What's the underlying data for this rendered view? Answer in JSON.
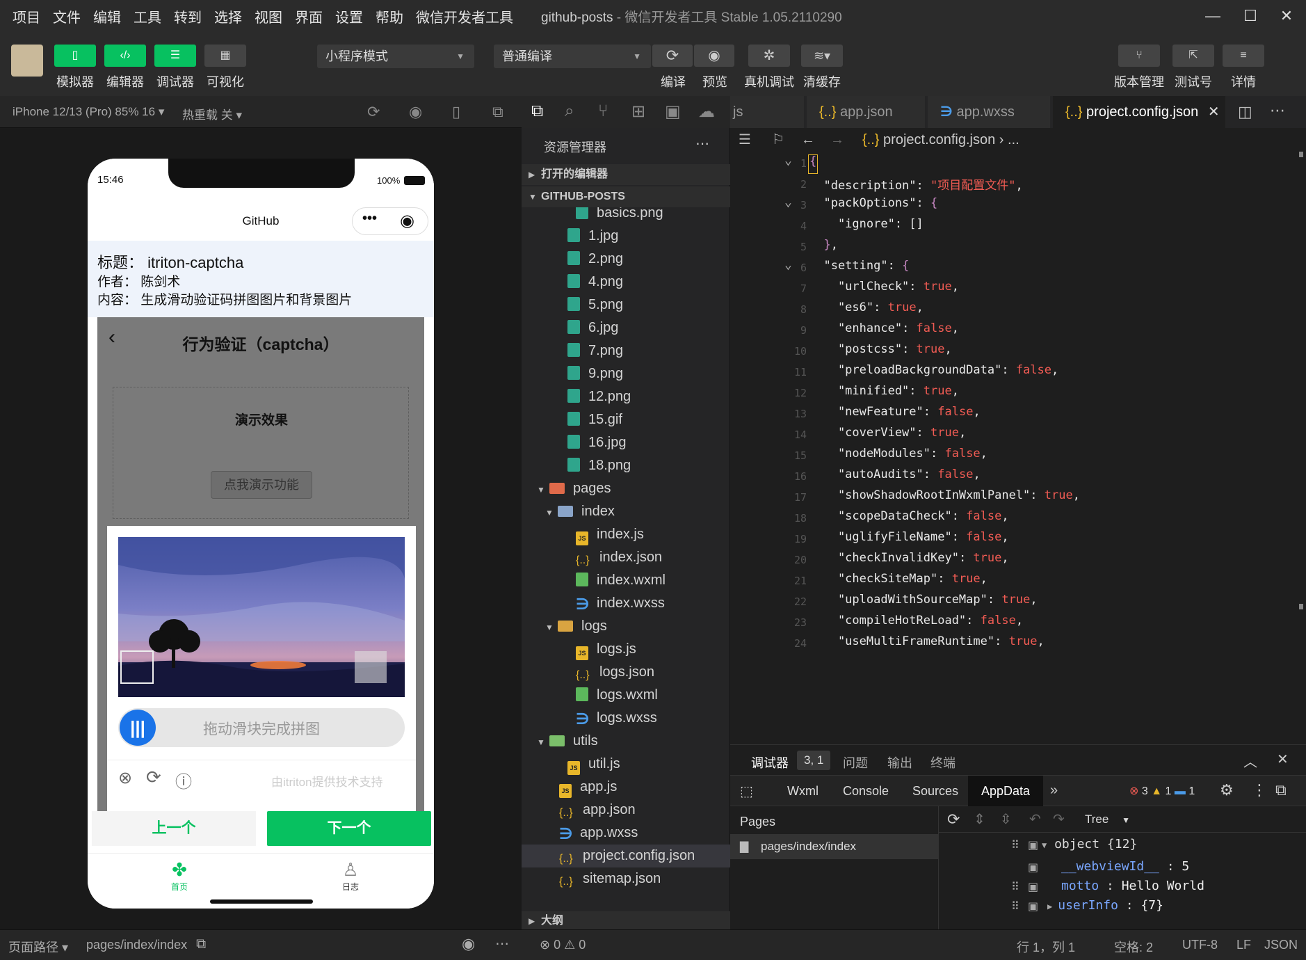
{
  "menubar": {
    "items": [
      "项目",
      "文件",
      "编辑",
      "工具",
      "转到",
      "选择",
      "视图",
      "界面",
      "设置",
      "帮助",
      "微信开发者工具"
    ],
    "project": "github-posts",
    "title_suffix": "- 微信开发者工具 Stable 1.05.2110290"
  },
  "toolbar": {
    "simulator": "模拟器",
    "editor": "编辑器",
    "debugger": "调试器",
    "visual": "可视化",
    "mode": "小程序模式",
    "compile_mode": "普通编译",
    "compile": "编译",
    "preview": "预览",
    "real_debug": "真机调试",
    "clear_cache": "清缓存",
    "version": "版本管理",
    "test_account": "测试号",
    "details": "详情"
  },
  "simbar": {
    "device": "iPhone 12/13 (Pro) 85% 16",
    "hot_reload": "热重载 关"
  },
  "phone": {
    "time": "15:46",
    "battery": "100%",
    "nav_title": "GitHub",
    "title_label": "标题：",
    "title_value": "itriton-captcha",
    "author_label": "作者：",
    "author_value": "陈剑术",
    "content_label": "内容：",
    "content_value": "生成滑动验证码拼图图片和背景图片",
    "captcha_title": "行为验证（captcha）",
    "demo_effect": "演示效果",
    "demo_button": "点我演示功能",
    "slider_text": "拖动滑块完成拼图",
    "powered_by": "由itriton提供技术支持",
    "prev": "上一个",
    "next": "下一个",
    "tab_home": "首页",
    "tab_logs": "日志"
  },
  "left_status": {
    "path_label": "页面路径",
    "path": "pages/index/index"
  },
  "explorer": {
    "title": "资源管理器",
    "open_editors": "打开的编辑器",
    "project": "GITHUB-POSTS",
    "outline": "大纲",
    "items": [
      {
        "name": "basics.png",
        "type": "img",
        "depth": 2
      },
      {
        "name": "1.jpg",
        "type": "img",
        "depth": 1
      },
      {
        "name": "2.png",
        "type": "img",
        "depth": 1
      },
      {
        "name": "4.png",
        "type": "img",
        "depth": 1
      },
      {
        "name": "5.png",
        "type": "img",
        "depth": 1
      },
      {
        "name": "6.jpg",
        "type": "img",
        "depth": 1
      },
      {
        "name": "7.png",
        "type": "img",
        "depth": 1
      },
      {
        "name": "9.png",
        "type": "img",
        "depth": 1
      },
      {
        "name": "12.png",
        "type": "img",
        "depth": 1
      },
      {
        "name": "15.gif",
        "type": "img",
        "depth": 1
      },
      {
        "name": "16.jpg",
        "type": "img",
        "depth": 1
      },
      {
        "name": "18.png",
        "type": "img",
        "depth": 1
      },
      {
        "name": "pages",
        "type": "folder-red",
        "depth": 0
      },
      {
        "name": "index",
        "type": "folder-blue",
        "depth": 1
      },
      {
        "name": "index.js",
        "type": "js",
        "depth": 2
      },
      {
        "name": "index.json",
        "type": "json",
        "depth": 2
      },
      {
        "name": "index.wxml",
        "type": "wxml",
        "depth": 2
      },
      {
        "name": "index.wxss",
        "type": "wxss",
        "depth": 2
      },
      {
        "name": "logs",
        "type": "folder",
        "depth": 1
      },
      {
        "name": "logs.js",
        "type": "js",
        "depth": 2
      },
      {
        "name": "logs.json",
        "type": "json",
        "depth": 2
      },
      {
        "name": "logs.wxml",
        "type": "wxml",
        "depth": 2
      },
      {
        "name": "logs.wxss",
        "type": "wxss",
        "depth": 2
      },
      {
        "name": "utils",
        "type": "folder-green",
        "depth": 0
      },
      {
        "name": "util.js",
        "type": "js",
        "depth": 1
      },
      {
        "name": "app.js",
        "type": "js",
        "depth": 0
      },
      {
        "name": "app.json",
        "type": "json",
        "depth": 0
      },
      {
        "name": "app.wxss",
        "type": "wxss",
        "depth": 0
      },
      {
        "name": "project.config.json",
        "type": "json",
        "depth": 0
      },
      {
        "name": "sitemap.json",
        "type": "json",
        "depth": 0
      }
    ]
  },
  "tabs": [
    {
      "label": "js",
      "icon": ""
    },
    {
      "label": "app.json",
      "icon": "{..}"
    },
    {
      "label": "app.wxss",
      "icon": "wxss"
    },
    {
      "label": "project.config.json",
      "icon": "{..}"
    }
  ],
  "breadcrumb": "project.config.json",
  "breadcrumb_more": "...",
  "code_lines": [
    [
      {
        "t": "{",
        "c": "p"
      }
    ],
    [
      {
        "t": "  \"description\"",
        "c": "k"
      },
      {
        "t": ": ",
        "c": "k"
      },
      {
        "t": "\"项目配置文件\"",
        "c": "s"
      },
      {
        "t": ",",
        "c": "k"
      }
    ],
    [
      {
        "t": "  \"packOptions\"",
        "c": "k"
      },
      {
        "t": ": ",
        "c": "k"
      },
      {
        "t": "{",
        "c": "p"
      }
    ],
    [
      {
        "t": "    \"ignore\"",
        "c": "k"
      },
      {
        "t": ": []",
        "c": "k"
      }
    ],
    [
      {
        "t": "  }",
        "c": "p"
      },
      {
        "t": ",",
        "c": "k"
      }
    ],
    [
      {
        "t": "  \"setting\"",
        "c": "k"
      },
      {
        "t": ": ",
        "c": "k"
      },
      {
        "t": "{",
        "c": "p"
      }
    ],
    [
      {
        "t": "    \"urlCheck\"",
        "c": "k"
      },
      {
        "t": ": ",
        "c": "k"
      },
      {
        "t": "true",
        "c": "b"
      },
      {
        "t": ",",
        "c": "k"
      }
    ],
    [
      {
        "t": "    \"es6\"",
        "c": "k"
      },
      {
        "t": ": ",
        "c": "k"
      },
      {
        "t": "true",
        "c": "b"
      },
      {
        "t": ",",
        "c": "k"
      }
    ],
    [
      {
        "t": "    \"enhance\"",
        "c": "k"
      },
      {
        "t": ": ",
        "c": "k"
      },
      {
        "t": "false",
        "c": "b"
      },
      {
        "t": ",",
        "c": "k"
      }
    ],
    [
      {
        "t": "    \"postcss\"",
        "c": "k"
      },
      {
        "t": ": ",
        "c": "k"
      },
      {
        "t": "true",
        "c": "b"
      },
      {
        "t": ",",
        "c": "k"
      }
    ],
    [
      {
        "t": "    \"preloadBackgroundData\"",
        "c": "k"
      },
      {
        "t": ": ",
        "c": "k"
      },
      {
        "t": "false",
        "c": "b"
      },
      {
        "t": ",",
        "c": "k"
      }
    ],
    [
      {
        "t": "    \"minified\"",
        "c": "k"
      },
      {
        "t": ": ",
        "c": "k"
      },
      {
        "t": "true",
        "c": "b"
      },
      {
        "t": ",",
        "c": "k"
      }
    ],
    [
      {
        "t": "    \"newFeature\"",
        "c": "k"
      },
      {
        "t": ": ",
        "c": "k"
      },
      {
        "t": "false",
        "c": "b"
      },
      {
        "t": ",",
        "c": "k"
      }
    ],
    [
      {
        "t": "    \"coverView\"",
        "c": "k"
      },
      {
        "t": ": ",
        "c": "k"
      },
      {
        "t": "true",
        "c": "b"
      },
      {
        "t": ",",
        "c": "k"
      }
    ],
    [
      {
        "t": "    \"nodeModules\"",
        "c": "k"
      },
      {
        "t": ": ",
        "c": "k"
      },
      {
        "t": "false",
        "c": "b"
      },
      {
        "t": ",",
        "c": "k"
      }
    ],
    [
      {
        "t": "    \"autoAudits\"",
        "c": "k"
      },
      {
        "t": ": ",
        "c": "k"
      },
      {
        "t": "false",
        "c": "b"
      },
      {
        "t": ",",
        "c": "k"
      }
    ],
    [
      {
        "t": "    \"showShadowRootInWxmlPanel\"",
        "c": "k"
      },
      {
        "t": ": ",
        "c": "k"
      },
      {
        "t": "true",
        "c": "b"
      },
      {
        "t": ",",
        "c": "k"
      }
    ],
    [
      {
        "t": "    \"scopeDataCheck\"",
        "c": "k"
      },
      {
        "t": ": ",
        "c": "k"
      },
      {
        "t": "false",
        "c": "b"
      },
      {
        "t": ",",
        "c": "k"
      }
    ],
    [
      {
        "t": "    \"uglifyFileName\"",
        "c": "k"
      },
      {
        "t": ": ",
        "c": "k"
      },
      {
        "t": "false",
        "c": "b"
      },
      {
        "t": ",",
        "c": "k"
      }
    ],
    [
      {
        "t": "    \"checkInvalidKey\"",
        "c": "k"
      },
      {
        "t": ": ",
        "c": "k"
      },
      {
        "t": "true",
        "c": "b"
      },
      {
        "t": ",",
        "c": "k"
      }
    ],
    [
      {
        "t": "    \"checkSiteMap\"",
        "c": "k"
      },
      {
        "t": ": ",
        "c": "k"
      },
      {
        "t": "true",
        "c": "b"
      },
      {
        "t": ",",
        "c": "k"
      }
    ],
    [
      {
        "t": "    \"uploadWithSourceMap\"",
        "c": "k"
      },
      {
        "t": ": ",
        "c": "k"
      },
      {
        "t": "true",
        "c": "b"
      },
      {
        "t": ",",
        "c": "k"
      }
    ],
    [
      {
        "t": "    \"compileHotReLoad\"",
        "c": "k"
      },
      {
        "t": ": ",
        "c": "k"
      },
      {
        "t": "false",
        "c": "b"
      },
      {
        "t": ",",
        "c": "k"
      }
    ],
    [
      {
        "t": "    \"useMultiFrameRuntime\"",
        "c": "k"
      },
      {
        "t": ": ",
        "c": "k"
      },
      {
        "t": "true",
        "c": "b"
      },
      {
        "t": ",",
        "c": "k"
      }
    ]
  ],
  "debugger": {
    "title": "调试器",
    "badge": "3, 1",
    "problems": "问题",
    "output": "输出",
    "terminal": "终端",
    "tabs": [
      "Wxml",
      "Console",
      "Sources",
      "AppData"
    ],
    "more": "»",
    "errors": "3",
    "warnings": "1",
    "infos": "1",
    "pages_label": "Pages",
    "page_item": "pages/index/index",
    "view_mode": "Tree",
    "root": "object {12}",
    "rows": [
      {
        "key": "__webviewId__",
        "value": "5"
      },
      {
        "key": "motto",
        "value": "Hello World"
      },
      {
        "key": "userInfo",
        "value": "{7}"
      }
    ]
  },
  "right_status": {
    "errors": "0",
    "warnings": "0",
    "position": "行 1，列 1",
    "spaces": "空格: 2",
    "encoding": "UTF-8",
    "eol": "LF",
    "lang": "JSON"
  },
  "colors": {
    "accent": "#07c160",
    "slider": "#1a73e8",
    "error": "#f25c54"
  }
}
